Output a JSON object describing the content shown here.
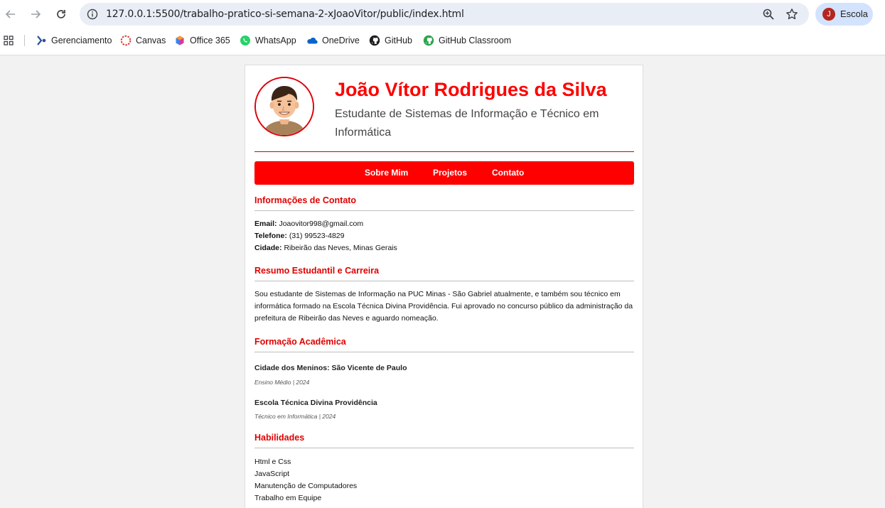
{
  "browser": {
    "url": "127.0.0.1:5500/trabalho-pratico-si-semana-2-xJoaoVitor/public/index.html",
    "profile_initial": "J",
    "profile_name": "Escola",
    "bookmarks": [
      "Gerenciamento",
      "Canvas",
      "Office 365",
      "WhatsApp",
      "OneDrive",
      "GitHub",
      "GitHub Classroom"
    ]
  },
  "header": {
    "name": "João Vítor Rodrigues da Silva",
    "subtitle": "Estudante de Sistemas de Informação e Técnico em Informática"
  },
  "menu": {
    "items": [
      "Sobre Mim",
      "Projetos",
      "Contato"
    ]
  },
  "contact": {
    "title": "Informações de Contato",
    "email_label": "Email:",
    "email": "Joaovitor998@gmail.com",
    "phone_label": "Telefone:",
    "phone": "(31) 99523-4829",
    "city_label": "Cidade:",
    "city": "Ribeirão das Neves, Minas Gerais"
  },
  "resume": {
    "title": "Resumo Estudantil e Carreira",
    "text": "Sou estudante de Sistemas de Informação na PUC Minas - São Gabriel atualmente, e também sou técnico em informática formado na Escola Técnica Divina Providência. Fui aprovado no concurso público da administração da prefeitura de Ribeirão das Neves e aguardo nomeação."
  },
  "education": {
    "title": "Formação Acadêmica",
    "items": [
      {
        "school": "Cidade dos Meninos: São Vicente de Paulo",
        "meta": "Ensino Médio | 2024"
      },
      {
        "school": "Escola Técnica Divina Providência",
        "meta": "Técnico em Informática | 2024"
      }
    ]
  },
  "skills": {
    "title": "Habilidades",
    "items": [
      "Html e Css",
      "JavaScript",
      "Manutenção de Computadores",
      "Trabalho em Equipe"
    ]
  },
  "colors": {
    "accent": "#ff0000",
    "page_background": "#f2f2f2"
  }
}
